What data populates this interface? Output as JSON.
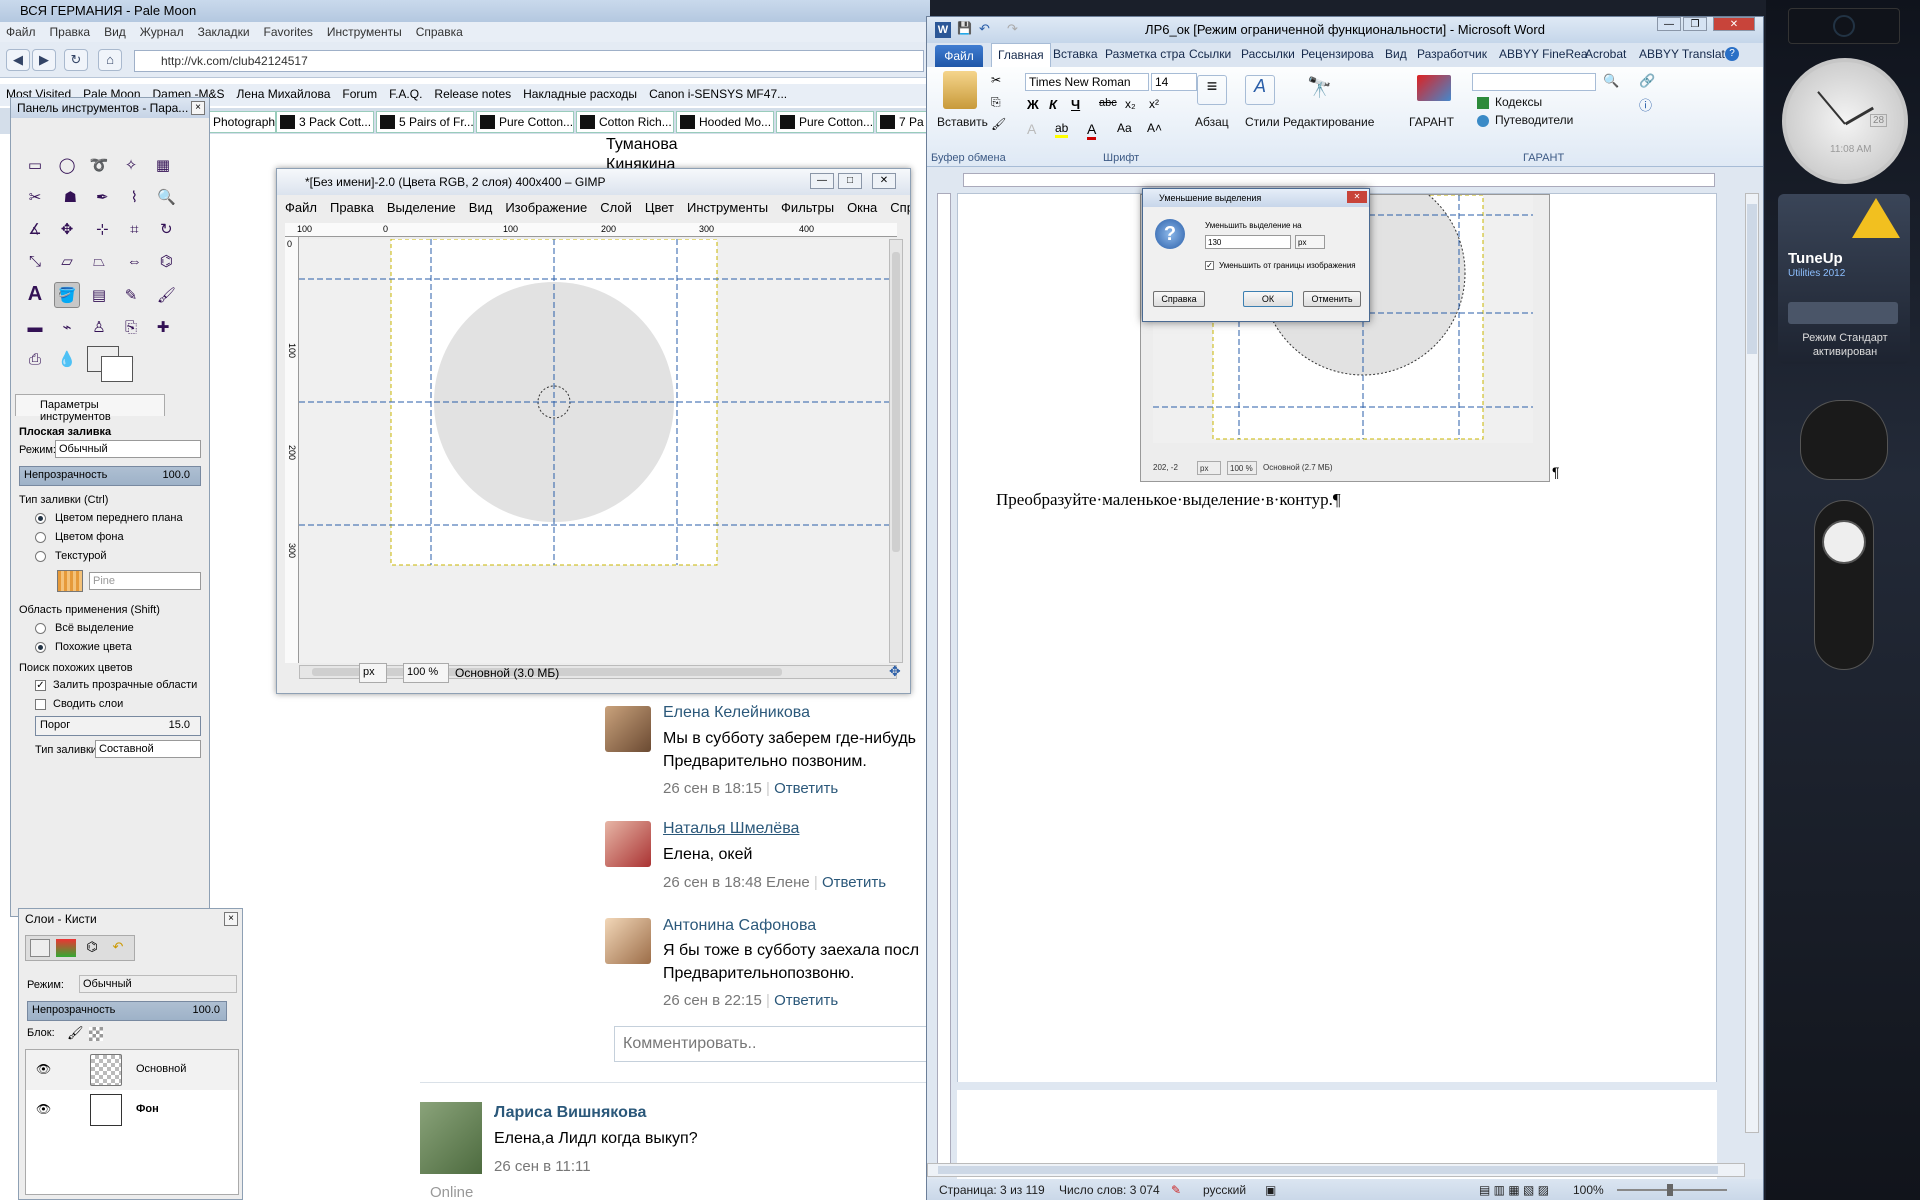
{
  "browser": {
    "title": "ВСЯ ГЕРМАНИЯ - Pale Moon",
    "menu": [
      "Файл",
      "Правка",
      "Вид",
      "Журнал",
      "Закладки",
      "Favorites",
      "Инструменты",
      "Справка"
    ],
    "url": "http://vk.com/club42124517",
    "bookmarks": [
      "Most Visited",
      "Pale Moon",
      "Damen -M&S",
      "Лена Михайлова",
      "Forum",
      "F.A.Q.",
      "Release notes",
      "Накладные расходы",
      "Canon i-SENSYS MF47..."
    ],
    "tabs": [
      "Photograph ...",
      "3 Pack Cott...",
      "5 Pairs of Fr...",
      "Pure Cotton...",
      "Cotton Rich...",
      "Hooded Mo...",
      "Pure Cotton...",
      "7 Pa"
    ],
    "vk_top_names": [
      "Туманова",
      "Кинякина"
    ],
    "comments": [
      {
        "name": "Елена Келейникова",
        "text1": "Мы в субботу заберем где-нибудь",
        "text2": "Предварительно позвоним.",
        "date": "26 сен в 18:15",
        "sep": "|",
        "reply": "Ответить"
      },
      {
        "name": "Наталья Шмелёва",
        "text1": "Елена, окей",
        "text2": "",
        "date": "26 сен в 18:48 Елене",
        "sep": "|",
        "reply": "Ответить"
      },
      {
        "name": "Антонина Сафонова",
        "text1": "Я бы тоже в субботу заехала посл",
        "text2": "Предварительнопозвоню.",
        "date": "26 сен в 22:15",
        "sep": "|",
        "reply": "Ответить"
      }
    ],
    "comment_placeholder": "Комментировать..",
    "post": {
      "name": "Лариса Вишнякова",
      "text": "Елена,а Лидл когда выкуп?",
      "date": "26 сен в 11:11",
      "online": "Online"
    }
  },
  "gimp_toolbox": {
    "title": "Панель инструментов - Пара...",
    "tool_icons": [
      "rect-select",
      "ellipse-select",
      "free-select",
      "fuzzy-select",
      "color-select",
      "scissors",
      "foreground-select",
      "paths",
      "color-picker",
      "zoom",
      "measure",
      "move",
      "align",
      "crop",
      "rotate",
      "scale",
      "shear",
      "perspective",
      "flip",
      "cage",
      "text",
      "bucket-fill",
      "blend",
      "pencil",
      "paintbrush",
      "eraser",
      "airbrush",
      "ink",
      "clone",
      "heal",
      "perspective-clone",
      "blur",
      "smudge",
      "dodge-burn"
    ],
    "options_tab": "Параметры инструментов",
    "tool_name": "Плоская заливка",
    "mode_label": "Режим:",
    "mode_value": "Обычный",
    "opacity_label": "Непрозрачность",
    "opacity_value": "100.0",
    "fill_type_label": "Тип заливки  (Ctrl)",
    "fill_options": [
      "Цветом переднего плана",
      "Цветом фона",
      "Текстурой"
    ],
    "pattern_name": "Pine",
    "area_label": "Область применения  (Shift)",
    "area_options": [
      "Всё выделение",
      "Похожие цвета"
    ],
    "similar_label": "Поиск похожих цветов",
    "check_transparent": "Залить прозрачные области",
    "check_merge": "Сводить слои",
    "threshold_label": "Порог",
    "threshold_value": "15.0",
    "fill_by_label": "Тип заливки:",
    "fill_by_value": "Составной"
  },
  "gimp_layers": {
    "title": "Слои - Кисти",
    "mode_label": "Режим:",
    "mode_value": "Обычный",
    "opacity_label": "Непрозрачность",
    "opacity_value": "100.0",
    "lock_label": "Блок:",
    "layers": [
      "Основной",
      "Фон"
    ]
  },
  "gimp_image": {
    "title": "*[Без имени]-2.0 (Цвета RGB, 2 слоя) 400x400 – GIMP",
    "menu": [
      "Файл",
      "Правка",
      "Выделение",
      "Вид",
      "Изображение",
      "Слой",
      "Цвет",
      "Инструменты",
      "Фильтры",
      "Окна",
      "Справк"
    ],
    "ruler_h": [
      "100",
      "0",
      "100",
      "200",
      "300",
      "400"
    ],
    "ruler_v": [
      "0",
      "100",
      "200",
      "300"
    ],
    "unit": "px",
    "zoom": "100 %",
    "status": "Основной (3.0 МБ)"
  },
  "word": {
    "title": "ЛР6_ок [Режим ограниченной функциональности]  -  Microsoft Word",
    "file_tab": "Файл",
    "tabs": [
      "Главная",
      "Вставка",
      "Разметка стра",
      "Ссылки",
      "Рассылки",
      "Рецензирова",
      "Вид",
      "Разработчик",
      "ABBYY FineRea",
      "Acrobat",
      "ABBYY Translat"
    ],
    "paste_label": "Вставить",
    "clipboard_label": "Буфер обмена",
    "font_name": "Times New Roman",
    "font_size": "14",
    "font_group": "Шрифт",
    "paragraph_label": "Абзац",
    "styles_label": "Стили",
    "editing_label": "Редактирование",
    "garant_label": "ГАРАНТ",
    "garant_group": "ГАРАНТ",
    "garant_items": [
      "Кодексы",
      "Путеводители"
    ],
    "body_text": "Преобразуйте·маленькое·выделение·в·контур.¶",
    "pilcrow": "¶",
    "embedded_status": {
      "coords": "202, -2",
      "unit": "px",
      "zoom": "100 %",
      "layer": "Основной (2.7 МБ)"
    },
    "status": {
      "page": "Страница: 3 из 119",
      "words": "Число слов: 3 074",
      "lang": "русский",
      "zoom": "100%"
    }
  },
  "dialog": {
    "title": "Уменьшение выделения",
    "label": "Уменьшить выделение на",
    "value": "130",
    "unit": "px",
    "checkbox": "Уменьшить от границы изображения",
    "help": "Справка",
    "ok": "ОК",
    "cancel": "Отменить"
  },
  "sidebar": {
    "clock_time": "11:08 AM",
    "clock_day": "28",
    "tuneup_title": "TuneUp",
    "tuneup_sub": "Utilities 2012",
    "mode_line1": "Режим Стандарт",
    "mode_line2": "активирован"
  }
}
